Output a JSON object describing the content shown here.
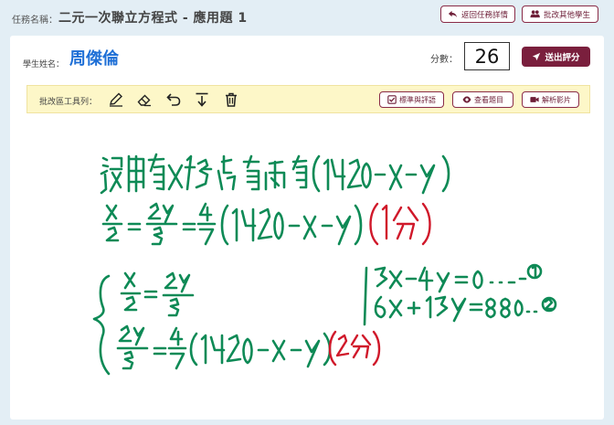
{
  "header": {
    "task_label": "任務名稱：",
    "task_title": "二元一次聯立方程式 - 應用題 1",
    "back_button": "返回任務詳情",
    "grade_others_button": "批改其他學生"
  },
  "student": {
    "name_label": "學生姓名：",
    "name": "周傑倫"
  },
  "score": {
    "label": "分數：",
    "value": "26"
  },
  "submit_button": "送出評分",
  "toolbar": {
    "label": "批改區工具列：",
    "tools": [
      "pen-icon",
      "eraser-icon",
      "undo-icon",
      "download-icon",
      "trash-icon"
    ],
    "standards_button": "標準與評語",
    "view_question_button": "查看題目",
    "video_button": "解析影片"
  },
  "colors": {
    "accent": "#7a1f3d",
    "student_name": "#1e6fd6",
    "ink_green": "#0e8a56",
    "ink_red": "#d0182a",
    "toolbar_bg": "#fdf7c8",
    "page_bg": "#e3eef5"
  }
}
